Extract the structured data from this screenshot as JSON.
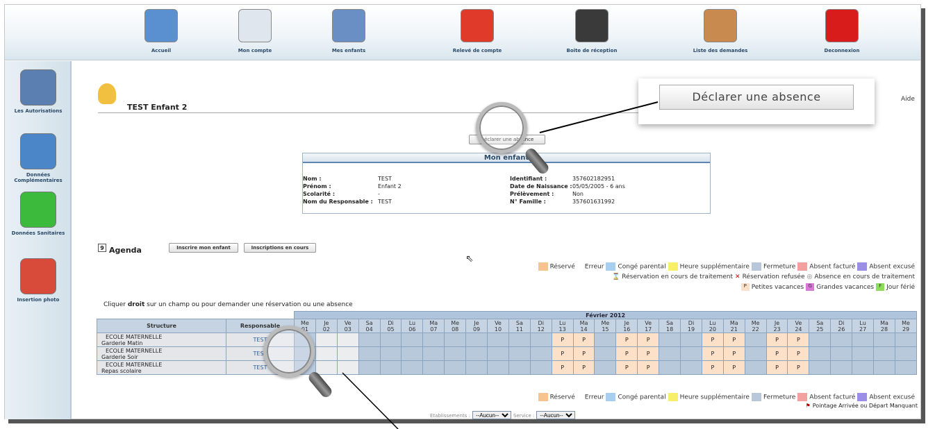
{
  "topnav": {
    "items": [
      {
        "label": "Accueil",
        "icon": "house-icon"
      },
      {
        "label": "Mon compte",
        "icon": "document-icon"
      },
      {
        "label": "Mes enfants",
        "icon": "photo-icon"
      },
      {
        "label": "Relevé de compte",
        "icon": "euro-icon"
      },
      {
        "label": "Boite de réception",
        "icon": "inbox-icon"
      },
      {
        "label": "Liste des demandes",
        "icon": "box-icon"
      },
      {
        "label": "Deconnexion",
        "icon": "power-icon"
      }
    ]
  },
  "sidebar": {
    "items": [
      {
        "label": "Les Autorisations",
        "icon": "users-lock-icon"
      },
      {
        "label": "Données Complémentaires",
        "icon": "folder-icon"
      },
      {
        "label": "Données Sanitaires",
        "icon": "green-cross-icon"
      },
      {
        "label": "Insertion photo",
        "icon": "photo-insert-icon"
      }
    ]
  },
  "header": {
    "child_name": "TEST Enfant 2",
    "aide": "Aide"
  },
  "absence_button": "Déclarer une absence",
  "absence_button_small": "Déclarer une absence",
  "mon_enfant": {
    "title": "Mon enfant",
    "left": [
      {
        "k": "Nom :",
        "v": "TEST"
      },
      {
        "k": "Prénom :",
        "v": "Enfant 2"
      },
      {
        "k": "Scolarité :",
        "v": "-"
      },
      {
        "k": "Nom du Responsable :",
        "v": "TEST"
      }
    ],
    "right": [
      {
        "k": "Identifiant :",
        "v": "357602182951"
      },
      {
        "k": "Date de Naissance :",
        "v": "05/05/2005 - 6 ans"
      },
      {
        "k": "Prélèvement :",
        "v": "Non"
      },
      {
        "k": "N° Famille :",
        "v": "357601631992"
      }
    ]
  },
  "agenda": {
    "icon_num": "9",
    "title": "Agenda",
    "btn_inscrire": "Inscrire mon enfant",
    "btn_inscriptions": "Inscriptions en cours",
    "instruction_pre": "Cliquer ",
    "instruction_bold": "droit",
    "instruction_post": " sur un champ ou pour demander une réservation ou une absence"
  },
  "legend": {
    "line1": [
      {
        "label": "Réservé",
        "color": "#f6c48e"
      },
      {
        "label": "Erreur",
        "color": ""
      },
      {
        "label": "Congé parental",
        "color": "#a9cff0"
      },
      {
        "label": "Heure supplémentaire",
        "color": "#f7ef6a"
      },
      {
        "label": "Fermeture",
        "color": "#b8c8da"
      },
      {
        "label": "Absent facturé",
        "color": "#f2a0a0"
      },
      {
        "label": "Absent excusé",
        "color": "#9a8ee6"
      }
    ],
    "line2": [
      "Réservation en cours de traitement",
      "Réservation refusée",
      "Absence en cours de traitement"
    ],
    "line3": [
      "Petites vacances",
      "Grandes vacances",
      "Jour férié"
    ],
    "pointage": "Pointage Arrivée ou Départ Manquant"
  },
  "calendar": {
    "month": "Février 2012",
    "col_structure": "Structure",
    "col_responsable": "Responsable",
    "days": [
      [
        "Me",
        "01"
      ],
      [
        "Je",
        "02"
      ],
      [
        "Ve",
        "03"
      ],
      [
        "Sa",
        "04"
      ],
      [
        "Di",
        "05"
      ],
      [
        "Lu",
        "06"
      ],
      [
        "Ma",
        "07"
      ],
      [
        "Me",
        "08"
      ],
      [
        "Je",
        "09"
      ],
      [
        "Ve",
        "10"
      ],
      [
        "Sa",
        "11"
      ],
      [
        "Di",
        "12"
      ],
      [
        "Lu",
        "13"
      ],
      [
        "Ma",
        "14"
      ],
      [
        "Me",
        "15"
      ],
      [
        "Je",
        "16"
      ],
      [
        "Ve",
        "17"
      ],
      [
        "Sa",
        "18"
      ],
      [
        "Di",
        "19"
      ],
      [
        "Lu",
        "20"
      ],
      [
        "Ma",
        "21"
      ],
      [
        "Me",
        "22"
      ],
      [
        "Je",
        "23"
      ],
      [
        "Ve",
        "24"
      ],
      [
        "Sa",
        "25"
      ],
      [
        "Di",
        "26"
      ],
      [
        "Lu",
        "27"
      ],
      [
        "Ma",
        "28"
      ],
      [
        "Me",
        "29"
      ]
    ],
    "rows": [
      {
        "school": "ECOLE MATERNELLE",
        "service": "Garderie Matin",
        "resp": "TEST"
      },
      {
        "school": "ECOLE MATERNELLE",
        "service": "Garderie Soir",
        "resp": "TEST"
      },
      {
        "school": "ECOLE MATERNELLE",
        "service": "Repas scolaire",
        "resp": "TEST"
      }
    ],
    "p_mark": "P"
  },
  "filters": {
    "etab_label": "Etablissements :",
    "etab_value": "--Aucun--",
    "service_label": "Service :",
    "service_value": "--Aucun--"
  }
}
